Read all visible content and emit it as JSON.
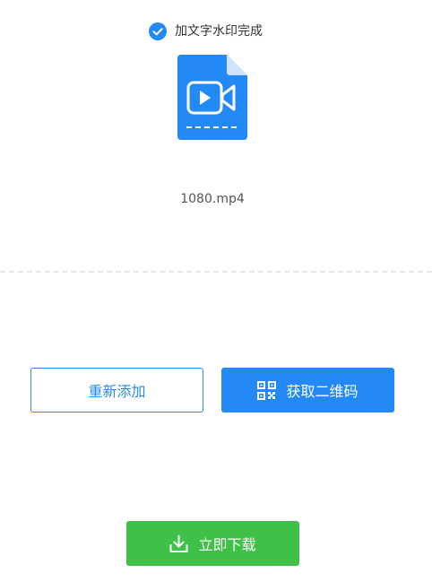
{
  "status": {
    "icon": "check-circle-icon",
    "text": "加文字水印完成",
    "color": "#2289f6"
  },
  "file": {
    "icon": "video-file-icon",
    "name": "1080.mp4",
    "color": "#2289f6"
  },
  "actions": {
    "readd_label": "重新添加",
    "qrcode_label": "获取二维码",
    "qrcode_icon": "qr-code-icon",
    "download_label": "立即下载",
    "download_icon": "download-icon"
  },
  "colors": {
    "primary_blue": "#2289f6",
    "outline_blue": "#2a89ee",
    "download_green": "#3ec049"
  }
}
